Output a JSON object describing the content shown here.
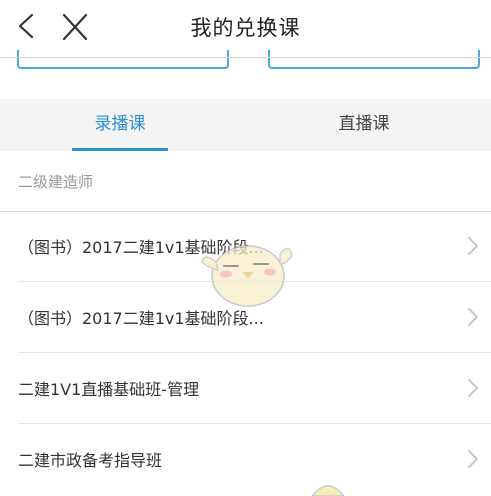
{
  "header": {
    "title": "我的兑换课",
    "back_icon": "chevron-left-icon",
    "close_icon": "close-icon"
  },
  "tabs": [
    {
      "label": "录播课",
      "active": true
    },
    {
      "label": "直播课",
      "active": false
    }
  ],
  "section": {
    "label": "二级建造师"
  },
  "courses": [
    {
      "title": "（图书）2017二建1v1基础阶段..."
    },
    {
      "title": "（图书）2017二建1v1基础阶段..."
    },
    {
      "title": "二建1V1直播基础班-管理"
    },
    {
      "title": "二建市政备考指导班"
    }
  ],
  "colors": {
    "accent": "#2b8fd6",
    "card_border": "#4aa8e0",
    "tab_bar_bg": "#f4f4f4",
    "muted_text": "#999999"
  }
}
